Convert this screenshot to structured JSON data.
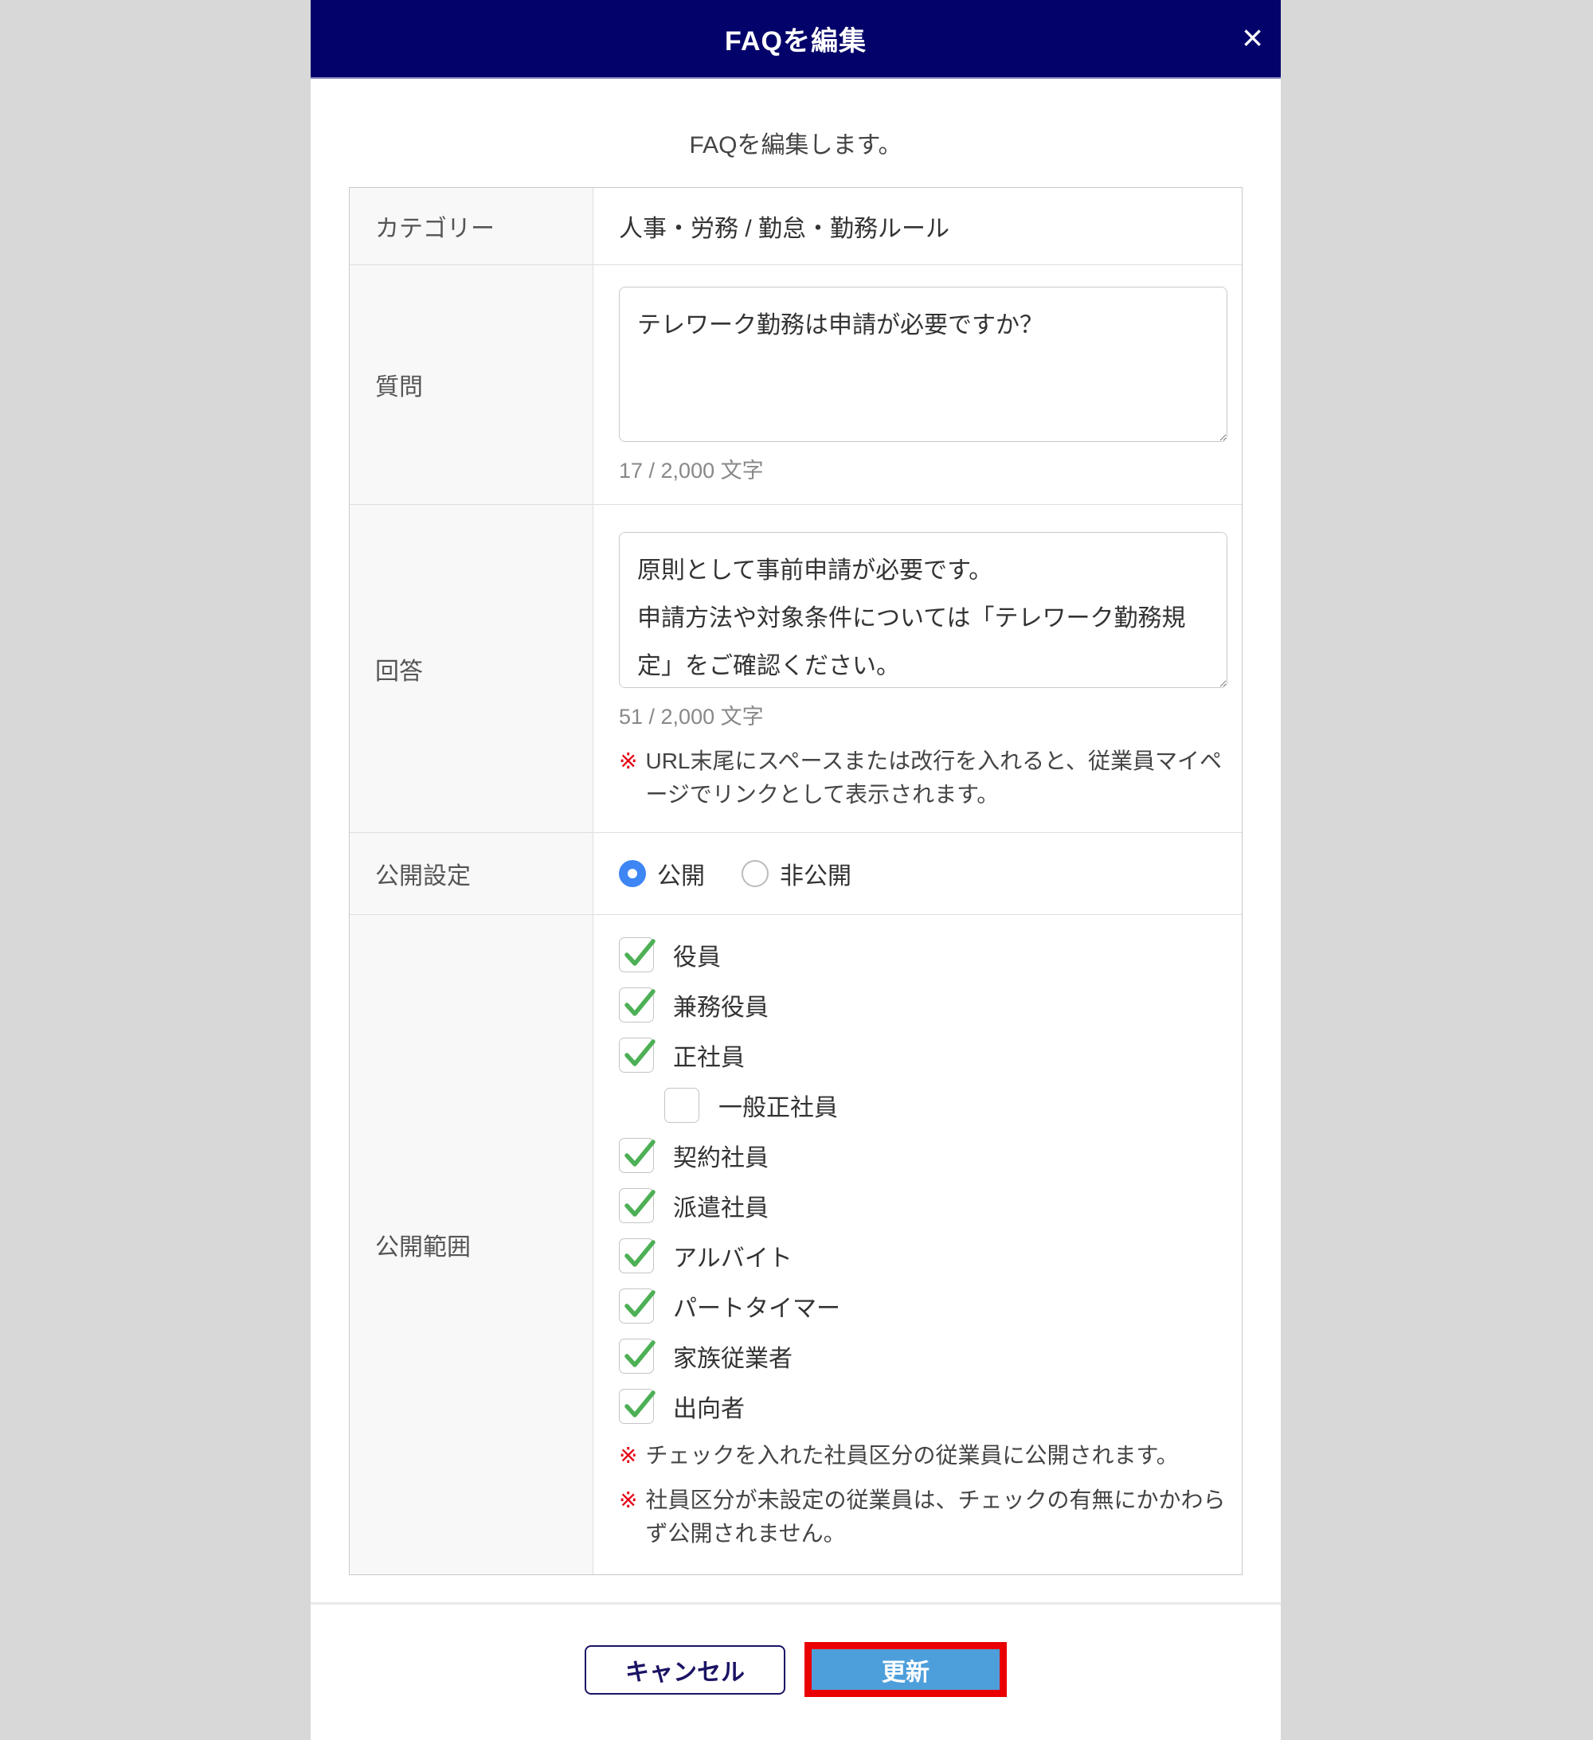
{
  "modal": {
    "title": "FAQを編集",
    "close_label": "×",
    "subtitle": "FAQを編集します。"
  },
  "form": {
    "category": {
      "label": "カテゴリー",
      "value": "人事・労務 / 勤怠・勤務ルール"
    },
    "question": {
      "label": "質問",
      "value": "テレワーク勤務は申請が必要ですか？",
      "counter": "17 / 2,000 文字"
    },
    "answer": {
      "label": "回答",
      "value": "原則として事前申請が必要です。\n申請方法や対象条件については「テレワーク勤務規定」をご確認ください。",
      "counter": "51 / 2,000 文字",
      "note": {
        "mark": "※",
        "text": "URL末尾にスペースまたは改行を入れると、従業員マイページでリンクとして表示されます。"
      }
    },
    "visibility": {
      "label": "公開設定",
      "options": [
        {
          "label": "公開",
          "selected": true
        },
        {
          "label": "非公開",
          "selected": false
        }
      ]
    },
    "scope": {
      "label": "公開範囲",
      "items": [
        {
          "label": "役員",
          "checked": true,
          "indent": false
        },
        {
          "label": "兼務役員",
          "checked": true,
          "indent": false
        },
        {
          "label": "正社員",
          "checked": true,
          "indent": false
        },
        {
          "label": "一般正社員",
          "checked": false,
          "indent": true
        },
        {
          "label": "契約社員",
          "checked": true,
          "indent": false
        },
        {
          "label": "派遣社員",
          "checked": true,
          "indent": false
        },
        {
          "label": "アルバイト",
          "checked": true,
          "indent": false
        },
        {
          "label": "パートタイマー",
          "checked": true,
          "indent": false
        },
        {
          "label": "家族従業者",
          "checked": true,
          "indent": false
        },
        {
          "label": "出向者",
          "checked": true,
          "indent": false
        }
      ],
      "notes": [
        {
          "mark": "※",
          "text": "チェックを入れた社員区分の従業員に公開されます。"
        },
        {
          "mark": "※",
          "text": "社員区分が未設定の従業員は、チェックの有無にかかわらず公開されません。"
        }
      ]
    }
  },
  "footer": {
    "cancel_label": "キャンセル",
    "submit_label": "更新"
  },
  "colors": {
    "header_bg": "#03026a",
    "radio_blue": "#3d86f3",
    "check_green": "#4db056",
    "submit_blue": "#4d9fdb",
    "annotation_red": "#ea0000",
    "note_red": "#e60012",
    "backdrop_gray": "#d8d8d8"
  }
}
